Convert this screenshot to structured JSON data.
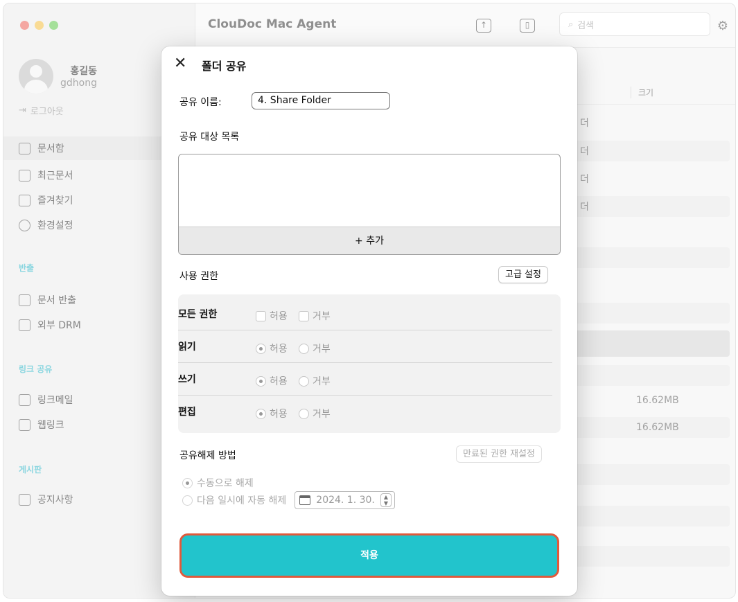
{
  "app": {
    "title": "ClouDoc Mac Agent",
    "search_placeholder": "검색"
  },
  "sidebar": {
    "user_name": "홍길동",
    "user_id": "gdhong",
    "logout": "로그아웃",
    "main_items": [
      {
        "label": "문서함",
        "icon": "folder-icon"
      },
      {
        "label": "최근문서",
        "icon": "recent-doc-icon"
      },
      {
        "label": "즐겨찾기",
        "icon": "favorite-doc-icon"
      },
      {
        "label": "환경설정",
        "icon": "gear-icon"
      }
    ],
    "section_export": "반출",
    "export_items": [
      {
        "label": "문서 반출",
        "icon": "export-icon"
      },
      {
        "label": "외부 DRM",
        "icon": "drm-icon"
      }
    ],
    "section_link": "링크 공유",
    "link_items": [
      {
        "label": "링크메일",
        "icon": "mail-link-icon"
      },
      {
        "label": "웹링크",
        "icon": "web-link-icon"
      }
    ],
    "section_board": "게시판",
    "board_items": [
      {
        "label": "공지사항",
        "icon": "megaphone-icon"
      }
    ]
  },
  "table": {
    "size_header": "크기",
    "row_type_fragment": "더",
    "sizes": [
      "16.62MB",
      "16.62MB"
    ]
  },
  "modal": {
    "title": "폴더 공유",
    "share_name_label": "공유 이름:",
    "share_name_value": "4. Share Folder",
    "target_list_label": "공유 대상 목록",
    "add_button": "+ 추가",
    "permission_label": "사용 권한",
    "advanced_button": "고급 설정",
    "permissions": [
      {
        "name": "모든 권한",
        "allow": "허용",
        "deny": "거부",
        "type": "checkbox"
      },
      {
        "name": "읽기",
        "allow": "허용",
        "deny": "거부",
        "type": "radio"
      },
      {
        "name": "쓰기",
        "allow": "허용",
        "deny": "거부",
        "type": "radio"
      },
      {
        "name": "편집",
        "allow": "허용",
        "deny": "거부",
        "type": "radio"
      }
    ],
    "unshare_label": "공유해제 방법",
    "reset_expired_button": "만료된 권한 재설정",
    "manual_option": "수동으로 해제",
    "auto_option": "다음 일시에 자동 해제",
    "auto_date": "2024.  1. 30.",
    "apply_button": "적용"
  },
  "colors": {
    "accent": "#22c4cc",
    "highlight_border": "#e05a3c",
    "section_label": "#2bb5c6"
  }
}
